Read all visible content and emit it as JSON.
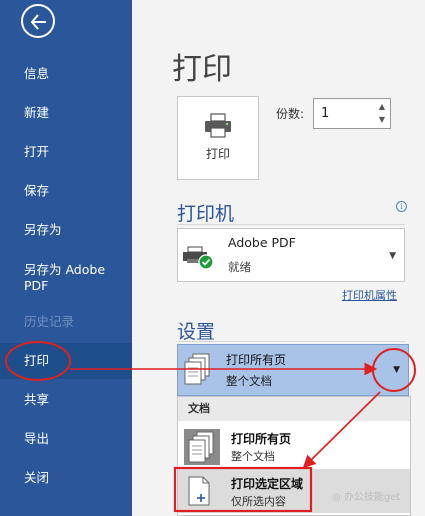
{
  "sidebar": {
    "items": [
      {
        "label": "信息"
      },
      {
        "label": "新建"
      },
      {
        "label": "打开"
      },
      {
        "label": "保存"
      },
      {
        "label": "另存为"
      },
      {
        "label": "另存为 Adobe PDF"
      },
      {
        "label": "历史记录"
      },
      {
        "label": "打印"
      },
      {
        "label": "共享"
      },
      {
        "label": "导出"
      },
      {
        "label": "关闭"
      }
    ]
  },
  "main": {
    "title": "打印",
    "print_button_label": "打印",
    "copies_label": "份数:",
    "copies_value": "1",
    "printer_section_title": "打印机",
    "printer_name": "Adobe PDF",
    "printer_status": "就绪",
    "printer_properties_link": "打印机属性",
    "settings_section_title": "设置",
    "range_title": "打印所有页",
    "range_subtitle": "整个文档",
    "menu": {
      "header": "文档",
      "items": [
        {
          "title": "打印所有页",
          "subtitle": "整个文档"
        },
        {
          "title": "打印选定区域",
          "subtitle": "仅所选内容"
        }
      ]
    }
  },
  "watermark": "办公技能get",
  "colors": {
    "sidebar": "#2b579a",
    "accent": "#2b579a",
    "annotation": "#e02020",
    "status_ok": "#1e9e3a"
  }
}
